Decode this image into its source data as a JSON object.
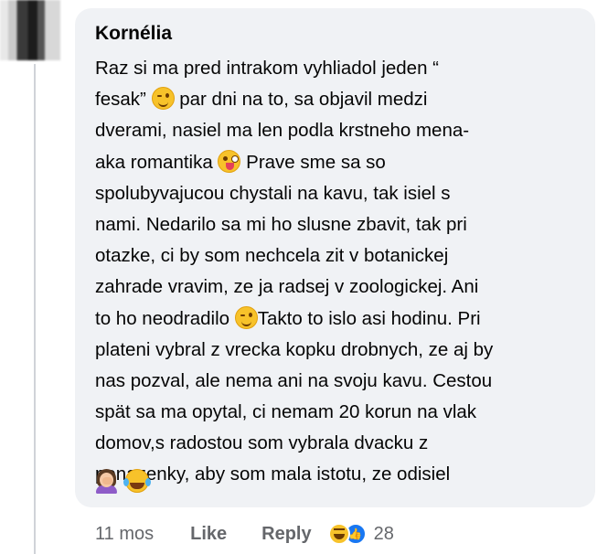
{
  "comment": {
    "author": "Kornélia",
    "lines": [
      {
        "pre": "Raz si ma pred intrakom vyhliadol jeden  “"
      },
      {
        "pre": "fesak” ",
        "emoji": "wink",
        "post": " par dni na to, sa objavil medzi"
      },
      {
        "pre": "dverami, nasiel ma len podla krstneho mena-"
      },
      {
        "pre": "aka romantika ",
        "emoji": "tongue",
        "post": " Prave sme sa so"
      },
      {
        "pre": "spolubyvajucou chystali na kavu, tak isiel s"
      },
      {
        "pre": "nami. Nedarilo sa mi ho slusne zbavit, tak pri"
      },
      {
        "pre": "otazke, ci by som nechcela zit v botanickej"
      },
      {
        "pre": "zahrade vravim, ze ja radsej v zoologickej. Ani"
      },
      {
        "pre": "to ho neodradilo ",
        "emoji": "wink",
        "post": "Takto to islo asi hodinu. Pri"
      },
      {
        "pre": "plateni vybral z vrecka kopku drobnych, ze aj by"
      },
      {
        "pre": "nas pozval, ale nema ani na svoju kavu. Cestou"
      },
      {
        "pre": "spät sa ma opytal, ci nemam 20 korun na vlak"
      },
      {
        "pre": "domov,s radostou som vybrala dvacku z"
      },
      {
        "pre": "penazenky, aby som mala istotu, ze odisiel"
      }
    ],
    "trailing_emojis": [
      "woman-facepalming",
      "face-with-tears-of-joy"
    ]
  },
  "footer": {
    "timestamp": "11 mos",
    "like_label": "Like",
    "reply_label": "Reply",
    "reactions": [
      "haha",
      "like"
    ],
    "reaction_count": "28"
  },
  "colors": {
    "bubble_bg": "#f0f2f5",
    "meta_text": "#65676b",
    "like_blue": "#1877f2"
  }
}
